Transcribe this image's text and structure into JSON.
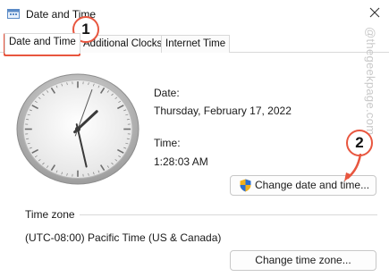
{
  "window": {
    "title": "Date and Time",
    "icon": "date-time-app-icon",
    "close_icon": "close-icon"
  },
  "tabs": [
    {
      "label": "Date and Time",
      "active": true
    },
    {
      "label": "Additional Clocks",
      "active": false
    },
    {
      "label": "Internet Time",
      "active": false
    }
  ],
  "date_time": {
    "date_label": "Date:",
    "date_value": "Thursday, February 17, 2022",
    "time_label": "Time:",
    "time_value": "1:28:03 AM",
    "change_button": "Change date and time...",
    "change_button_icon": "uac-shield-icon"
  },
  "clock": {
    "hour": 1,
    "minute": 28,
    "second": 3
  },
  "time_zone": {
    "heading": "Time zone",
    "value": "(UTC-08:00) Pacific Time (US & Canada)",
    "change_button": "Change time zone..."
  },
  "annotations": {
    "step1": "1",
    "step2": "2",
    "color": "#e8563f"
  },
  "watermark": "@thegeekpage.com"
}
